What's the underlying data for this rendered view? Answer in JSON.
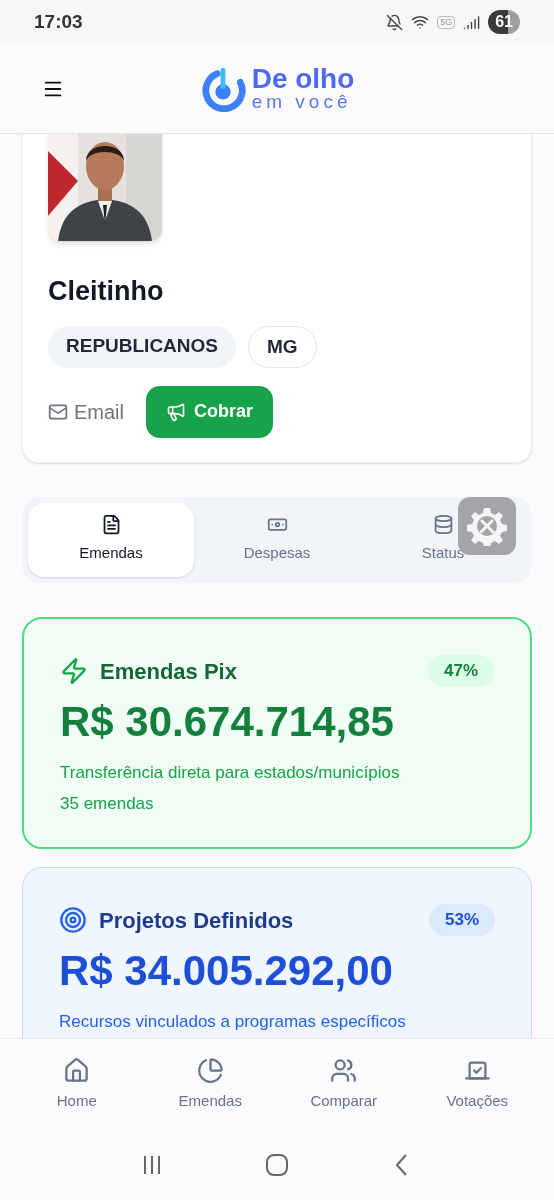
{
  "status_bar": {
    "time": "17:03",
    "network": "5G",
    "battery": "61"
  },
  "header": {
    "logo_top": "De olho",
    "logo_bottom": "em você"
  },
  "profile": {
    "name": "Cleitinho",
    "tags": [
      {
        "label": "REPUBLICANOS",
        "kind": "filled"
      },
      {
        "label": "MG",
        "kind": "outline"
      }
    ],
    "email_label": "Email",
    "action_label": "Cobrar"
  },
  "tabs": [
    {
      "label": "Emendas",
      "selected": true
    },
    {
      "label": "Despesas",
      "selected": false
    },
    {
      "label": "Status",
      "selected": false
    }
  ],
  "cards": [
    {
      "kind": "pix",
      "title": "Emendas Pix",
      "percent": "47%",
      "amount": "R$ 30.674.714,85",
      "description": "Transferência direta para estados/municípios",
      "count": "35 emendas"
    },
    {
      "kind": "projects",
      "title": "Projetos Definidos",
      "percent": "53%",
      "amount": "R$ 34.005.292,00",
      "description": "Recursos vinculados a programas específicos"
    }
  ],
  "bottom_nav": [
    {
      "label": "Home"
    },
    {
      "label": "Emendas"
    },
    {
      "label": "Comparar"
    },
    {
      "label": "Votações"
    }
  ]
}
